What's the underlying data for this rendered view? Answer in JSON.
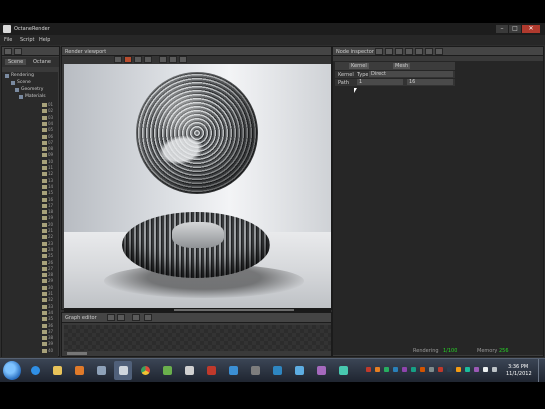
{
  "window": {
    "title": "OctaneRender",
    "controls": [
      "–",
      "□",
      "✕"
    ]
  },
  "menu": [
    "File",
    "Script",
    "Help"
  ],
  "scene_outliner": {
    "tabs": [
      "Scene",
      "Octane"
    ],
    "tree": [
      "Rendering",
      "Scene",
      "Geometry",
      "Materials"
    ],
    "thumbs": [
      "01",
      "02",
      "03",
      "04",
      "05",
      "06",
      "07",
      "08",
      "09",
      "10",
      "11",
      "12",
      "13",
      "14",
      "15",
      "16",
      "17",
      "18",
      "19",
      "20",
      "21",
      "22",
      "23",
      "24",
      "25",
      "26",
      "27",
      "28",
      "29",
      "30",
      "31",
      "32",
      "33",
      "34",
      "35",
      "36",
      "37",
      "38",
      "39",
      "40"
    ]
  },
  "render_viewport": {
    "title": "Render viewport",
    "status": "Rendering..."
  },
  "graph_editor": {
    "title": "Graph editor"
  },
  "node_inspector": {
    "title": "Node inspector",
    "tabs": [
      "Kernel",
      "Mesh"
    ],
    "row1": [
      "Kernel",
      "Type",
      "Direct"
    ],
    "row2": [
      "Path",
      "1",
      "16"
    ]
  },
  "status": {
    "left_label": "Rendering",
    "left_value": "1/100",
    "right_label": "Memory",
    "right_value": "256"
  },
  "taskbar": {
    "clock_time": "3:36 PM",
    "clock_date": "11/1/2012"
  },
  "colors": {
    "accent_status": "#28d428",
    "panel_bg": "#3a3a3a",
    "taskbar": "#2b3341"
  }
}
